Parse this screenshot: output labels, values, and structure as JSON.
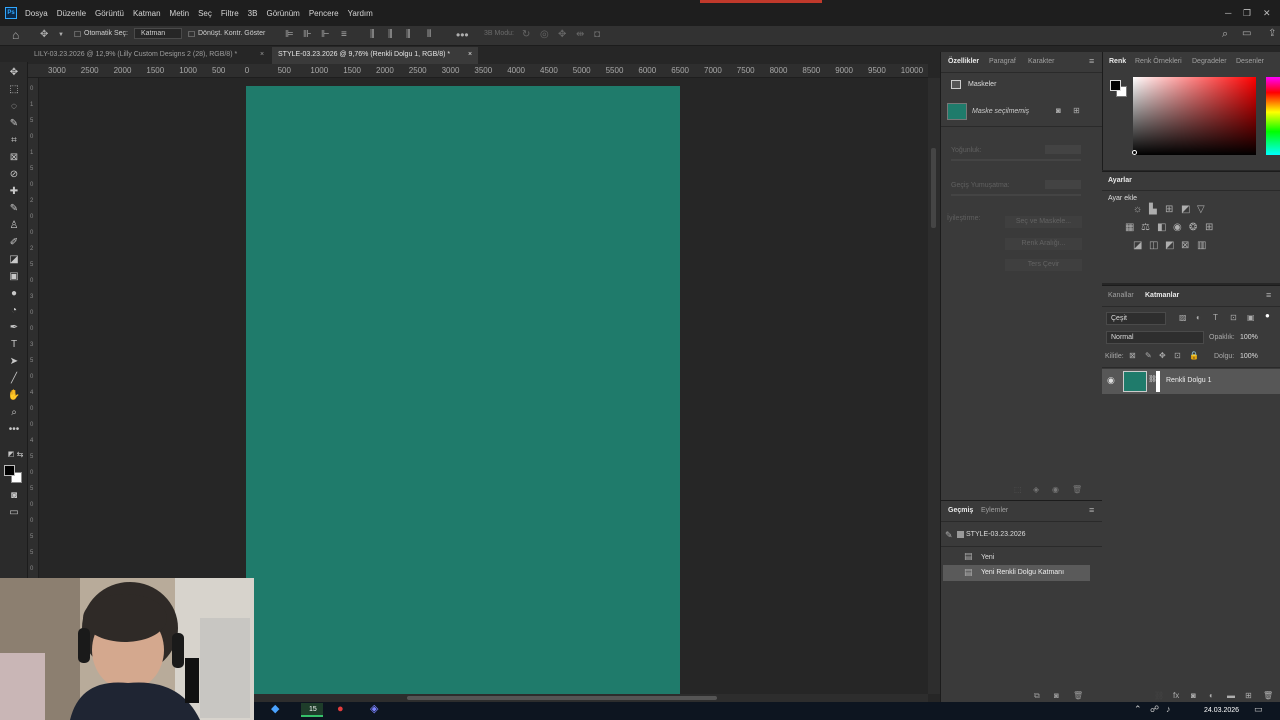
{
  "app": {
    "logo": "Ps"
  },
  "menu": [
    "Dosya",
    "Düzenle",
    "Görüntü",
    "Katman",
    "Metin",
    "Seç",
    "Filtre",
    "3B",
    "Görünüm",
    "Pencere",
    "Yardım"
  ],
  "options": {
    "auto_select": "Otomatik Seç:",
    "target": "Katman",
    "transform_controls": "Dönüşt. Kontr. Göster",
    "mode_3d": "3B Modu:"
  },
  "tabs": [
    {
      "label": "LILY-03.23.2026 @ 12,9% (Lilly Custom Designs 2 (28), RGB/8) *",
      "close": "×"
    },
    {
      "label": "STYLE-03.23.2026 @ 9,76% (Renkli Dolgu 1, RGB/8) *",
      "close": "×"
    }
  ],
  "ruler_h": [
    "3000",
    "2500",
    "2000",
    "1500",
    "1000",
    "500",
    "0",
    "500",
    "1000",
    "1500",
    "2000",
    "2500",
    "3000",
    "3500",
    "4000",
    "4500",
    "5000",
    "5500",
    "6000",
    "6500",
    "7000",
    "7500",
    "8000",
    "8500",
    "9000",
    "9500",
    "10000"
  ],
  "ruler_v": [
    "0",
    "1",
    "5",
    "0",
    "1",
    "5",
    "0",
    "2",
    "0",
    "0",
    "2",
    "5",
    "0",
    "3",
    "0",
    "0",
    "3",
    "5",
    "0",
    "4",
    "0",
    "0",
    "4",
    "5",
    "0",
    "5",
    "0",
    "0",
    "5",
    "5",
    "0"
  ],
  "canvas": {
    "fill": "#1f7b6b"
  },
  "properties": {
    "tabs": [
      "Özellikler",
      "Paragraf",
      "Karakter"
    ],
    "section": "Maskeler",
    "mask_status": "Maske seçilmemiş",
    "density": "Yoğunluk:",
    "feather": "Geçiş Yumuşatma:",
    "refine": "İyileştirme:",
    "select_mask": "Seç ve Maskele...",
    "color_range": "Renk Aralığı...",
    "invert": "Ters Çevir"
  },
  "history": {
    "tabs": [
      "Geçmiş",
      "Eylemler"
    ],
    "snapshot": "STYLE-03.23.2026",
    "items": [
      "Yeni",
      "Yeni Renkli Dolgu Katmanı"
    ]
  },
  "color_panel": {
    "tabs": [
      "Renk",
      "Renk Örnekleri",
      "Degradeler",
      "Desenler"
    ]
  },
  "adjustments": {
    "title": "Ayarlar",
    "add": "Ayar ekle"
  },
  "layers": {
    "tabs": [
      "Kanallar",
      "Katmanlar"
    ],
    "filter": "Çeşit",
    "blend_mode": "Normal",
    "opacity_label": "Opaklık:",
    "opacity": "100%",
    "lock_label": "Kilitle:",
    "fill_label": "Dolgu:",
    "fill": "100%",
    "layer_name": "Renkli Dolgu 1"
  },
  "taskbar": {
    "date": "24.03.2026",
    "badge": "15"
  }
}
